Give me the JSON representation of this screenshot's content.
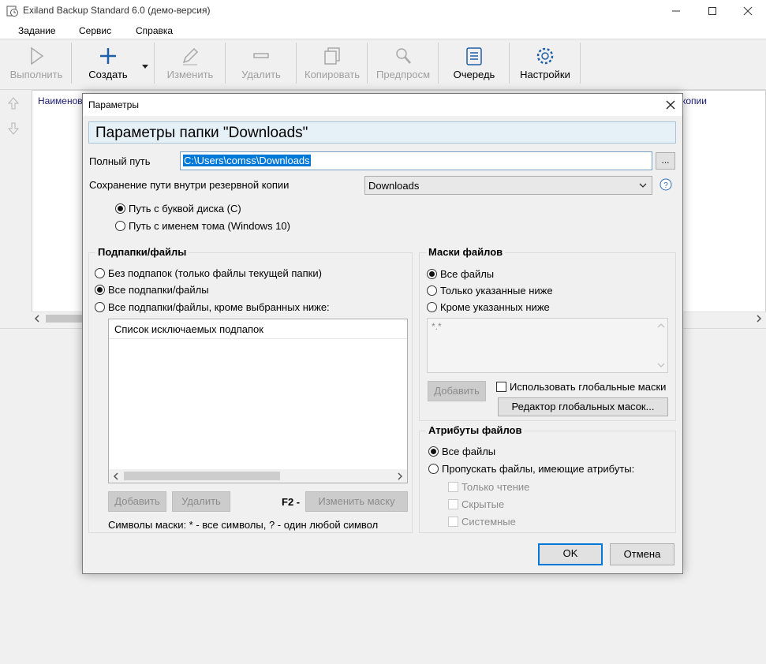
{
  "window": {
    "title": "Exiland Backup Standard 6.0 (демо-версия)"
  },
  "menu": {
    "items": [
      "Задание",
      "Сервис",
      "Справка"
    ]
  },
  "toolbar": {
    "run": "Выполнить",
    "create": "Создать",
    "edit": "Изменить",
    "delete": "Удалить",
    "copy": "Копировать",
    "preview": "Предпросм",
    "queue": "Очередь",
    "settings": "Настройки"
  },
  "list": {
    "col_name": "Наименов",
    "col_copies": "копии"
  },
  "dialog": {
    "title": "Параметры",
    "heading": "Параметры папки \"Downloads\"",
    "full_path_label": "Полный путь",
    "full_path_value": "C:\\Users\\comss\\Downloads",
    "browse_label": "...",
    "save_path_label": "Сохранение пути внутри резервной копии",
    "save_path_value": "Downloads",
    "radio_drive": "Путь с буквой диска (C)",
    "radio_volume": "Путь с именем тома (Windows 10)",
    "subfolders": {
      "title": "Подпапки/файлы",
      "opt_none": "Без подпапок (только файлы текущей папки)",
      "opt_all": "Все подпапки/файлы",
      "opt_except": "Все подпапки/файлы, кроме выбранных ниже:",
      "list_header": "Список исключаемых подпапок",
      "add": "Добавить",
      "remove": "Удалить",
      "f2": "F2 -",
      "change_mask": "Изменить маску",
      "hint": "Символы маски: * - все символы, ? - один любой символ"
    },
    "masks": {
      "title": "Маски файлов",
      "opt_all": "Все файлы",
      "opt_only": "Только указанные ниже",
      "opt_except": "Кроме указанных ниже",
      "text": "*.*",
      "add": "Добавить",
      "use_global": "Использовать глобальные маски",
      "global_editor": "Редактор глобальных масок..."
    },
    "attributes": {
      "title": "Атрибуты файлов",
      "opt_all": "Все файлы",
      "opt_skip": "Пропускать файлы, имеющие атрибуты:",
      "readonly": "Только чтение",
      "hidden": "Скрытые",
      "system": "Системные"
    },
    "ok": "OK",
    "cancel": "Отмена"
  }
}
